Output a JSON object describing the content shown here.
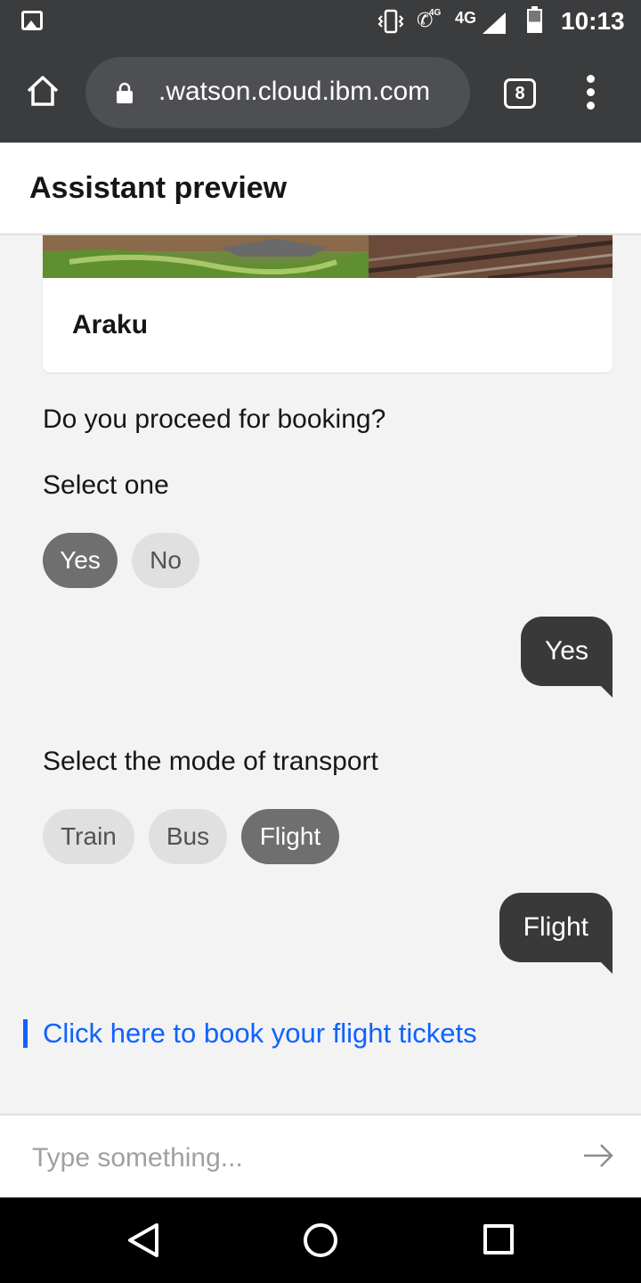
{
  "status_bar": {
    "time": "10:13",
    "network": "4G",
    "call_badge": "4G",
    "icons": [
      "gallery-icon",
      "vibrate-icon",
      "wifi-call-icon",
      "signal-icon",
      "battery-icon"
    ]
  },
  "browser": {
    "url": ".watson.cloud.ibm.com",
    "tab_count": "8",
    "icons": [
      "home-icon",
      "lock-icon",
      "tabs-icon",
      "overflow-menu-icon"
    ]
  },
  "header": {
    "title": "Assistant preview"
  },
  "chat": {
    "card": {
      "title": "Araku"
    },
    "booking_question": "Do you proceed for booking?",
    "booking_prompt": "Select one",
    "booking_options": [
      {
        "label": "Yes",
        "selected": true
      },
      {
        "label": "No",
        "selected": false
      }
    ],
    "user_reply_1": "Yes",
    "transport_prompt": "Select the mode of transport",
    "transport_options": [
      {
        "label": "Train",
        "selected": false
      },
      {
        "label": "Bus",
        "selected": false
      },
      {
        "label": "Flight",
        "selected": true
      }
    ],
    "user_reply_2": "Flight",
    "link_text": "Click here to book your flight tickets"
  },
  "input": {
    "placeholder": "Type something..."
  },
  "colors": {
    "accent_link": "#0f62fe",
    "selected_chip": "#6f6f6f",
    "user_bubble": "#393939",
    "chrome_bar": "#3b3c3e"
  }
}
